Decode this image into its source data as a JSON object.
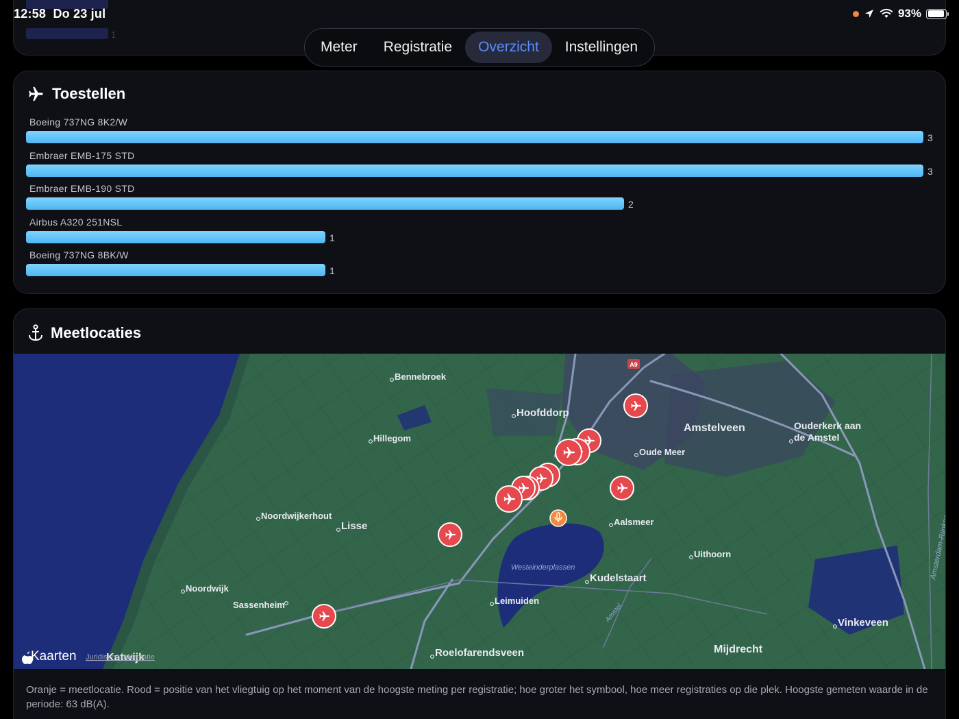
{
  "status_bar": {
    "time": "12:58",
    "date": "Do 23 jul",
    "battery": "93%",
    "battery_level": 0.93
  },
  "top_card_ghost": {
    "values": [
      "1",
      "1"
    ]
  },
  "tabs": [
    {
      "label": "Meter",
      "active": false
    },
    {
      "label": "Registratie",
      "active": false
    },
    {
      "label": "Overzicht",
      "active": true
    },
    {
      "label": "Instellingen",
      "active": false
    }
  ],
  "toestellen": {
    "title": "Toestellen",
    "icon": "airplane-icon",
    "bar_color": "#5ac2f7",
    "max_value": 3,
    "items": [
      {
        "label": "Boeing 737NG 8K2/W",
        "value": 3
      },
      {
        "label": "Embraer EMB-175 STD",
        "value": 3
      },
      {
        "label": "Embraer EMB-190 STD",
        "value": 2
      },
      {
        "label": "Airbus A320 251NSL",
        "value": 1
      },
      {
        "label": "Boeing 737NG 8BK/W",
        "value": 1
      }
    ]
  },
  "meetlocaties": {
    "title": "Meetlocaties",
    "icon": "anchor-icon",
    "map": {
      "brand": "Kaarten",
      "legal": "Juridische informatie",
      "road_sign": "A9",
      "places": [
        "Bennebroek",
        "Hoofddorp",
        "Amstelveen",
        "Ouderkerk aan",
        "de Amstel",
        "Hillegom",
        "Oude Meer",
        "Noordwijkerhout",
        "Lisse",
        "Aalsmeer",
        "Uithoorn",
        "Westeinderplassen",
        "Kudelstaart",
        "Noordwijk",
        "Sassenheim",
        "Leimuiden",
        "Katwijk",
        "Roelofarendsveen",
        "Vinkeveen",
        "Mijdrecht",
        "Amsterdam-Rijnkanaal",
        "Amstel"
      ],
      "colors": {
        "land": "#33654b",
        "water": "#1e2d7a",
        "urban": "#3d4863",
        "marker_red": "#e5484d",
        "marker_orange": "#f0883e"
      }
    },
    "caption": "Oranje = meetlocatie. Rood = positie van het vliegtuig op het moment van de hoogste meting per registratie; hoe groter het symbool, hoe meer registraties op die plek. Hoogste gemeten waarde in de periode: 63 dB(A)."
  }
}
